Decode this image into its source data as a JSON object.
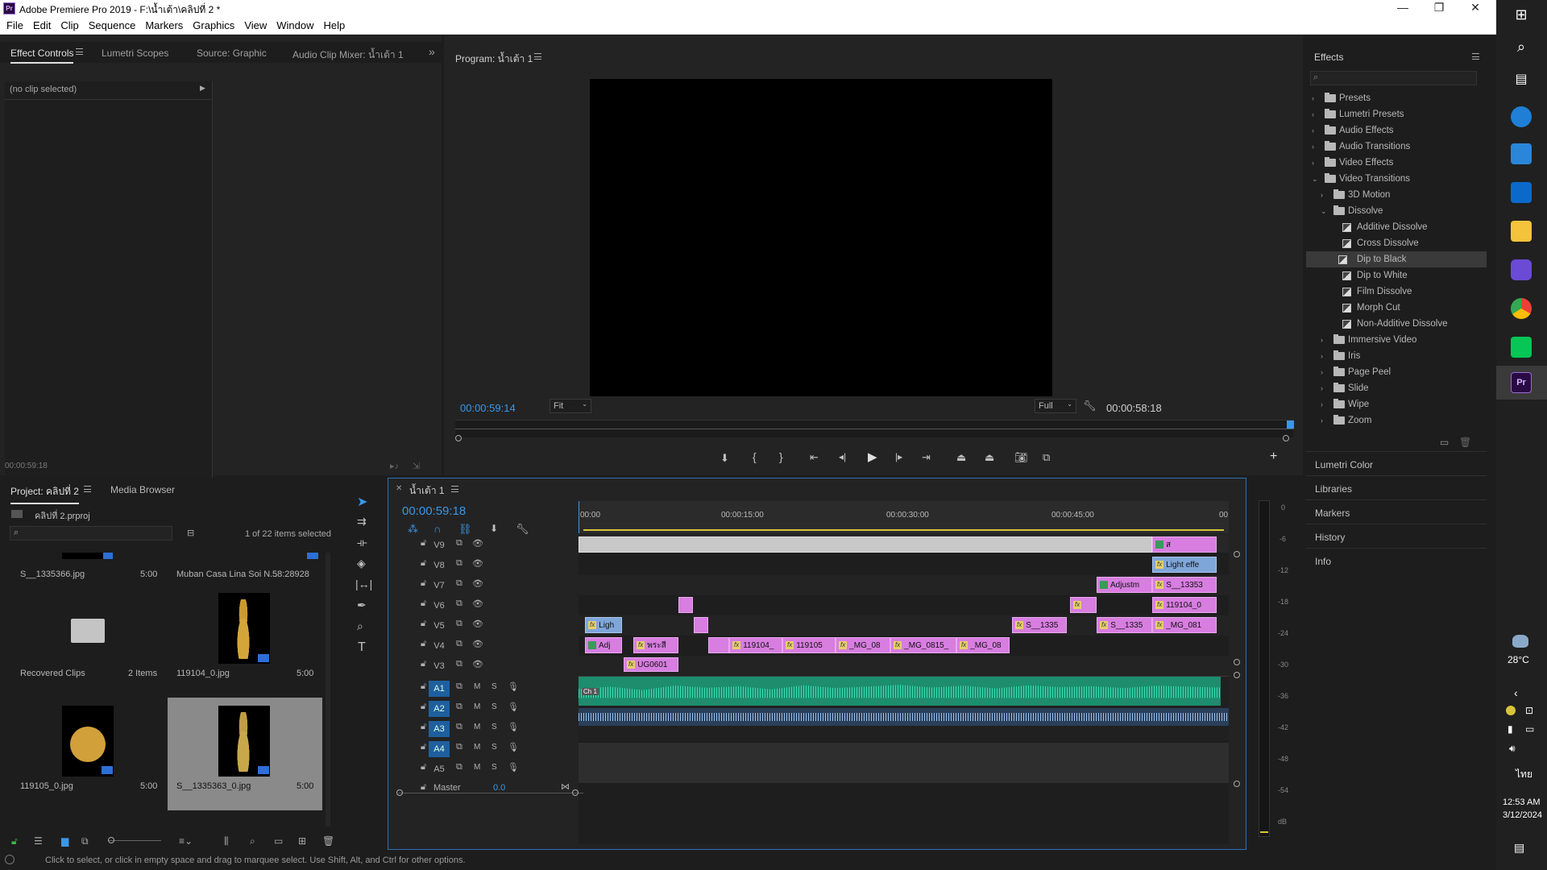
{
  "app": {
    "title": "Adobe Premiere Pro 2019 - F:\\น้ำเต้า\\คลิปที่ 2 *",
    "logo": "Pr"
  },
  "window_controls": {
    "minimize": "—",
    "maximize": "❐",
    "close": "✕"
  },
  "menu": [
    "File",
    "Edit",
    "Clip",
    "Sequence",
    "Markers",
    "Graphics",
    "View",
    "Window",
    "Help"
  ],
  "source_panel": {
    "tabs": [
      "Effect Controls",
      "Lumetri Scopes",
      "Source: Graphic",
      "Audio Clip Mixer: น้ำเต้า 1"
    ],
    "more": "»",
    "no_clip": "(no clip selected)",
    "timecode": "00:00:59:18"
  },
  "program": {
    "tab": "Program: น้ำเต้า 1",
    "timecode_left": "00:00:59:14",
    "fit": "Fit",
    "quality": "Full",
    "timecode_right": "00:00:58:18"
  },
  "effects": {
    "tab": "Effects",
    "items": [
      {
        "label": "Presets",
        "level": 0,
        "type": "folder",
        "open": false
      },
      {
        "label": "Lumetri Presets",
        "level": 0,
        "type": "folder",
        "open": false
      },
      {
        "label": "Audio Effects",
        "level": 0,
        "type": "folder",
        "open": false
      },
      {
        "label": "Audio Transitions",
        "level": 0,
        "type": "folder",
        "open": false
      },
      {
        "label": "Video Effects",
        "level": 0,
        "type": "folder",
        "open": false
      },
      {
        "label": "Video Transitions",
        "level": 0,
        "type": "folder",
        "open": true
      },
      {
        "label": "3D Motion",
        "level": 1,
        "type": "folder",
        "open": false
      },
      {
        "label": "Dissolve",
        "level": 1,
        "type": "folder",
        "open": true
      },
      {
        "label": "Additive Dissolve",
        "level": 2,
        "type": "fx"
      },
      {
        "label": "Cross Dissolve",
        "level": 2,
        "type": "fx"
      },
      {
        "label": "Dip to Black",
        "level": 2,
        "type": "fx",
        "selected": true
      },
      {
        "label": "Dip to White",
        "level": 2,
        "type": "fx"
      },
      {
        "label": "Film Dissolve",
        "level": 2,
        "type": "fx"
      },
      {
        "label": "Morph Cut",
        "level": 2,
        "type": "fx"
      },
      {
        "label": "Non-Additive Dissolve",
        "level": 2,
        "type": "fx"
      },
      {
        "label": "Immersive Video",
        "level": 1,
        "type": "folder",
        "open": false
      },
      {
        "label": "Iris",
        "level": 1,
        "type": "folder",
        "open": false
      },
      {
        "label": "Page Peel",
        "level": 1,
        "type": "folder",
        "open": false
      },
      {
        "label": "Slide",
        "level": 1,
        "type": "folder",
        "open": false
      },
      {
        "label": "Wipe",
        "level": 1,
        "type": "folder",
        "open": false
      },
      {
        "label": "Zoom",
        "level": 1,
        "type": "folder",
        "open": false
      }
    ],
    "collapsed_panels": [
      "Lumetri Color",
      "Libraries",
      "Markers",
      "History",
      "Info"
    ]
  },
  "project": {
    "tabs": [
      "Project: คลิปที่ 2",
      "Media Browser"
    ],
    "file": "คลิปที่ 2.prproj",
    "selection": "1 of 22 items selected",
    "items": [
      {
        "name": "S__1335366.jpg",
        "duration": "5:00"
      },
      {
        "name": "Muban Casa Lina Soi N...",
        "duration": "58:28928"
      },
      {
        "name": "Recovered Clips",
        "duration": "2 Items"
      },
      {
        "name": "119104_0.jpg",
        "duration": "5:00"
      },
      {
        "name": "119105_0.jpg",
        "duration": "5:00"
      },
      {
        "name": "S__1335363_0.jpg",
        "duration": "5:00"
      }
    ]
  },
  "timeline": {
    "tab": "น้ำเต้า 1",
    "timecode": "00:00:59:18",
    "ruler": [
      "00:00",
      "00:00:15:00",
      "00:00:30:00",
      "00:00:45:00",
      "00"
    ],
    "video_tracks": [
      "V9",
      "V8",
      "V7",
      "V6",
      "V5",
      "V4",
      "V3"
    ],
    "audio_tracks": [
      "A1",
      "A2",
      "A3",
      "A4",
      "A5"
    ],
    "master": "Master",
    "master_value": "0.0",
    "track_buttons": {
      "mute": "M",
      "solo": "S"
    },
    "clips": {
      "v9": "ส",
      "v8": "Light effe",
      "v7a": "Adjustm",
      "v7b": "S__13353",
      "v6": "119104_0",
      "v5a": "Ligh",
      "v5b": "S__1335",
      "v5c": "S__1335",
      "v5d": "_MG_081",
      "v4a": "Adj",
      "v4b": "พระสี",
      "v4c": "119104_",
      "v4d": "119105",
      "v4e": "_MG_08",
      "v4f": "_MG_0815_",
      "v4g": "_MG_08",
      "v3": "UG0601",
      "a1": "Ch 1"
    }
  },
  "vu_meter": {
    "scale": [
      "0",
      "-6",
      "-12",
      "-18",
      "-24",
      "-30",
      "-36",
      "-42",
      "-48",
      "-54",
      "dB"
    ]
  },
  "status": "Click to select, or click in empty space and drag to marquee select. Use Shift, Alt, and Ctrl for other options.",
  "taskbar": {
    "temp": "28°C",
    "lang": "ไทย",
    "time": "12:53 AM",
    "date": "3/12/2024"
  },
  "colors": {
    "accent": "#3a97e8",
    "clip_video": "#d77ee0",
    "clip_adjust": "#7fa6d9",
    "audio_wave": "#2fc9a4"
  }
}
